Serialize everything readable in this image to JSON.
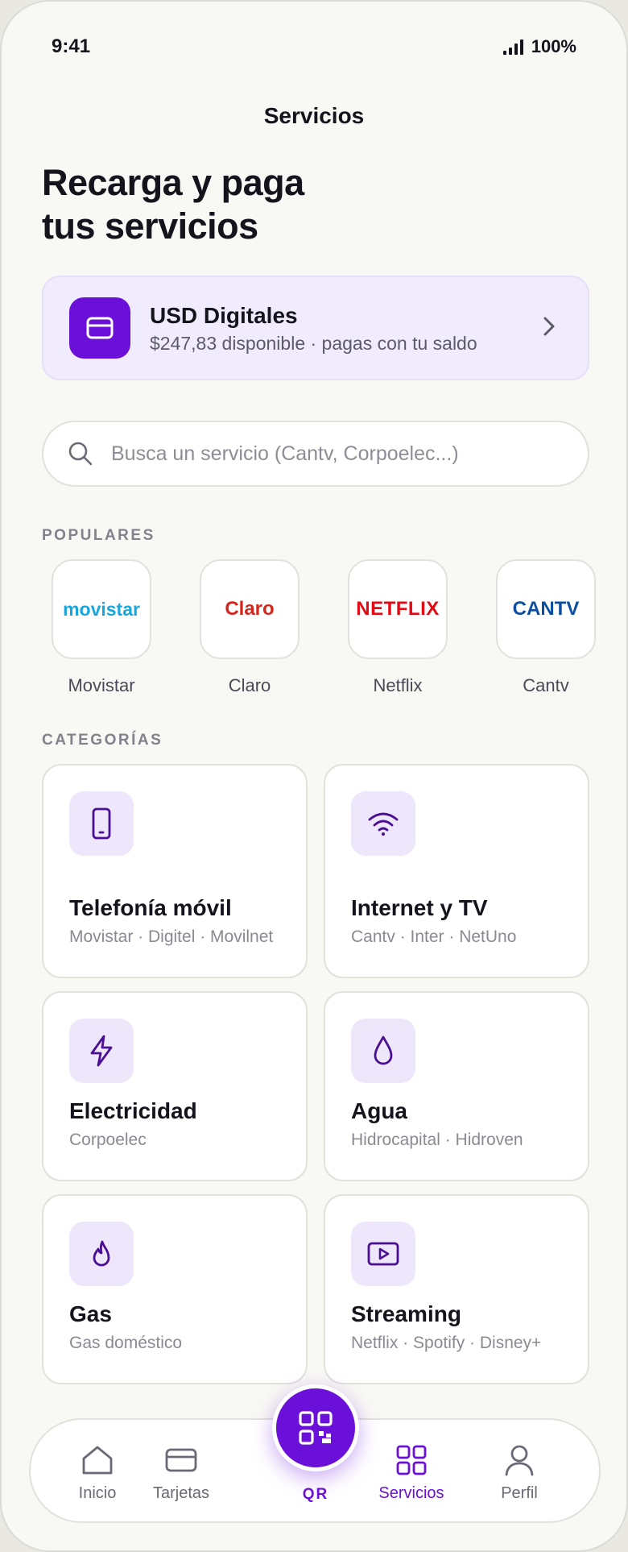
{
  "status_bar": {
    "time": "9:41",
    "battery": "100%"
  },
  "header": {
    "title": "Servicios"
  },
  "hero": {
    "line1": "Recarga y paga",
    "line2": "tus servicios"
  },
  "wallet": {
    "title": "USD Digitales",
    "subtitle": "$247,83 disponible · pagas con tu saldo"
  },
  "search": {
    "placeholder": "Busca un servicio (Cantv, Corpoelec...)",
    "value": ""
  },
  "popular": {
    "label": "POPULARES",
    "items": [
      {
        "name": "Movistar",
        "logo_text": "movistar",
        "color": "#19a6dc"
      },
      {
        "name": "Claro",
        "logo_text": "Claro",
        "color": "#d5261e"
      },
      {
        "name": "Netflix",
        "logo_text": "NETFLIX",
        "color": "#e50914"
      },
      {
        "name": "Cantv",
        "logo_text": "CANTV",
        "color": "#0d4ea1"
      }
    ]
  },
  "categories": {
    "label": "CATEGORÍAS",
    "items": [
      {
        "title": "Telefonía móvil",
        "subtitle": "Movistar · Digitel · Movilnet",
        "icon": "phone-icon"
      },
      {
        "title": "Internet y TV",
        "subtitle": "Cantv · Inter · NetUno",
        "icon": "wifi-icon"
      },
      {
        "title": "Electricidad",
        "subtitle": "Corpoelec",
        "icon": "lightning-icon"
      },
      {
        "title": "Agua",
        "subtitle": "Hidrocapital · Hidroven",
        "icon": "water-drop-icon"
      },
      {
        "title": "Gas",
        "subtitle": "Gas doméstico",
        "icon": "flame-icon"
      },
      {
        "title": "Streaming",
        "subtitle": "Netflix · Spotify · Disney+",
        "icon": "play-icon"
      }
    ]
  },
  "tabbar": {
    "items": [
      {
        "label": "Inicio",
        "icon": "home-icon"
      },
      {
        "label": "Tarjetas",
        "icon": "card-icon"
      },
      {
        "label": "QR",
        "icon": "qr-icon"
      },
      {
        "label": "Servicios",
        "icon": "grid-icon",
        "active": true
      },
      {
        "label": "Perfil",
        "icon": "user-icon"
      }
    ]
  },
  "colors": {
    "accent": "#6b10d8",
    "background": "#f8f8f4",
    "accent_soft": "#f1ecfd"
  }
}
